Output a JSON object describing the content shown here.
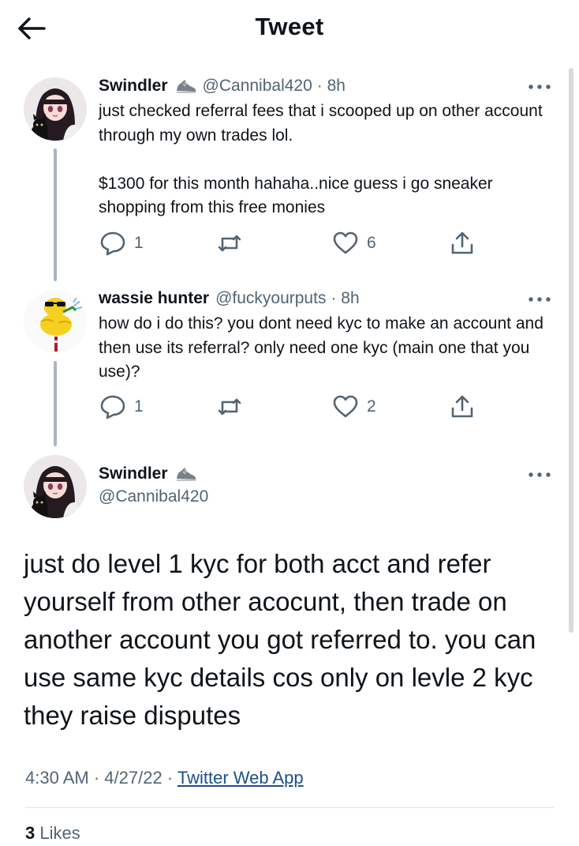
{
  "header": {
    "title": "Tweet",
    "back_icon": "arrow-left-icon"
  },
  "thread": [
    {
      "name": "Swindler",
      "badge_icon": "sneaker-icon",
      "handle": "@Cannibal420",
      "time": "· 8h",
      "text": "just checked referral fees that i scooped up on other account through my own trades lol.\n\n$1300 for this month hahaha..nice guess i go sneaker shopping from this free monies",
      "replies": "1",
      "likes": "6"
    },
    {
      "name": "wassie hunter",
      "handle": "@fuckyourputs",
      "time": "· 8h",
      "text": "how do i do this? you dont need kyc to make an account and then use its referral? only need one kyc (main one that you use)?",
      "replies": "1",
      "likes": "2"
    }
  ],
  "main_tweet": {
    "name": "Swindler",
    "badge_icon": "sneaker-icon",
    "handle": "@Cannibal420",
    "text": "just do level 1 kyc for both acct and refer yourself from other acocunt, then trade on another account you got referred to. you can use same kyc details cos only on levle 2 kyc they raise disputes",
    "time": "4:30 AM",
    "date": "4/27/22",
    "source": "Twitter Web App",
    "like_count": "3",
    "like_label": "Likes"
  },
  "icons": {
    "reply": "reply-bubble-icon",
    "retweet": "retweet-icon",
    "like": "heart-icon",
    "share": "share-icon",
    "more": "more-dots-icon"
  },
  "colors": {
    "text": "#0f1419",
    "secondary": "#536471",
    "thread_line": "#a9b5c2",
    "link": "#1d4f8a"
  }
}
